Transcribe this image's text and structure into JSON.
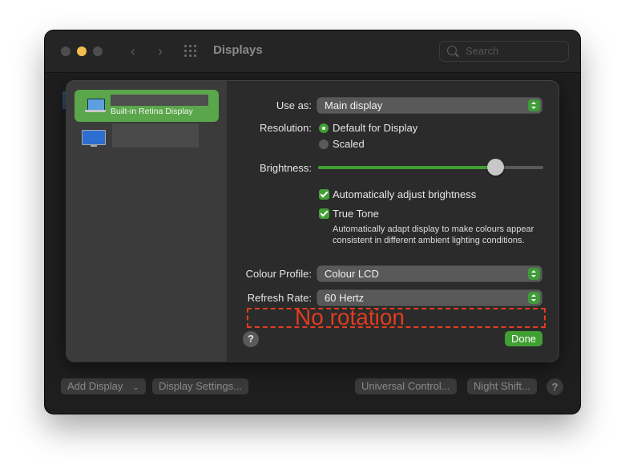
{
  "window": {
    "title": "Displays",
    "search_placeholder": "Search",
    "back_label": "‹",
    "forward_label": "›"
  },
  "bottom_bar": {
    "add_display": "Add Display",
    "add_display_chevron": "⌄",
    "display_settings": "Display Settings...",
    "universal_control": "Universal Control...",
    "night_shift": "Night Shift...",
    "help": "?"
  },
  "sidebar": {
    "displays": [
      {
        "subtitle": "Built-in Retina Display",
        "selected": true
      },
      {
        "subtitle": "",
        "selected": false
      }
    ]
  },
  "settings": {
    "use_as": {
      "label": "Use as:",
      "value": "Main display"
    },
    "resolution": {
      "label": "Resolution:",
      "options": [
        {
          "label": "Default for Display",
          "selected": true
        },
        {
          "label": "Scaled",
          "selected": false
        }
      ]
    },
    "brightness": {
      "label": "Brightness:",
      "value": 0.79
    },
    "auto_brightness": {
      "label": "Automatically adjust brightness",
      "checked": true
    },
    "true_tone": {
      "label": "True Tone",
      "checked": true,
      "description": "Automatically adapt display to make colours appear consistent in different ambient lighting conditions."
    },
    "colour_profile": {
      "label": "Colour Profile:",
      "value": "Colour LCD"
    },
    "refresh_rate": {
      "label": "Refresh Rate:",
      "value": "60 Hertz"
    }
  },
  "annotation": {
    "text": "No rotation"
  },
  "sheet_footer": {
    "help": "?",
    "done": "Done"
  },
  "colors": {
    "accent_green": "#41a033",
    "annotation_red": "#e13c1e",
    "selected_row": "#5aa64a"
  }
}
